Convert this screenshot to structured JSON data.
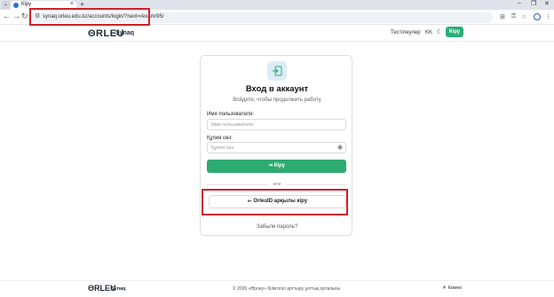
{
  "browser": {
    "tab_title": "Кіру",
    "tab_close": "×",
    "new_tab": "+",
    "url": "synaq.orleu.edu.kz/accounts/login/?next=/exam/95/",
    "win_min": "–",
    "win_max": "❐",
    "win_close": "✕"
  },
  "header": {
    "logo": "ΘRLEU",
    "logo_sub": "Synaq",
    "test_link": "Тестілеулер",
    "lang": "KK",
    "login_button": "Кіру"
  },
  "card": {
    "title": "Вход в аккаунт",
    "subtitle": "Войдите, чтобы продолжить работу",
    "username_label": "Имя пользователя:",
    "username_placeholder": "Имя пользователя",
    "password_label": "Құпия сөз:",
    "password_placeholder": "Құпия сөз",
    "submit_label": "⇥ Кіру",
    "or_text": "или",
    "orleuid_label": "⟜ OrleuID арқылы кіру",
    "forgot_label": "Забыли пароль?"
  },
  "footer": {
    "logo": "ΘRLEU",
    "logo_sub": "Synaq",
    "copyright": "© 2026 «Өрлеу» біліктілігі арттыру ұлттық орталығы",
    "theme_label": "☀ Көмек"
  },
  "colors": {
    "accent": "#2dab71",
    "highlight": "#d0202a"
  }
}
